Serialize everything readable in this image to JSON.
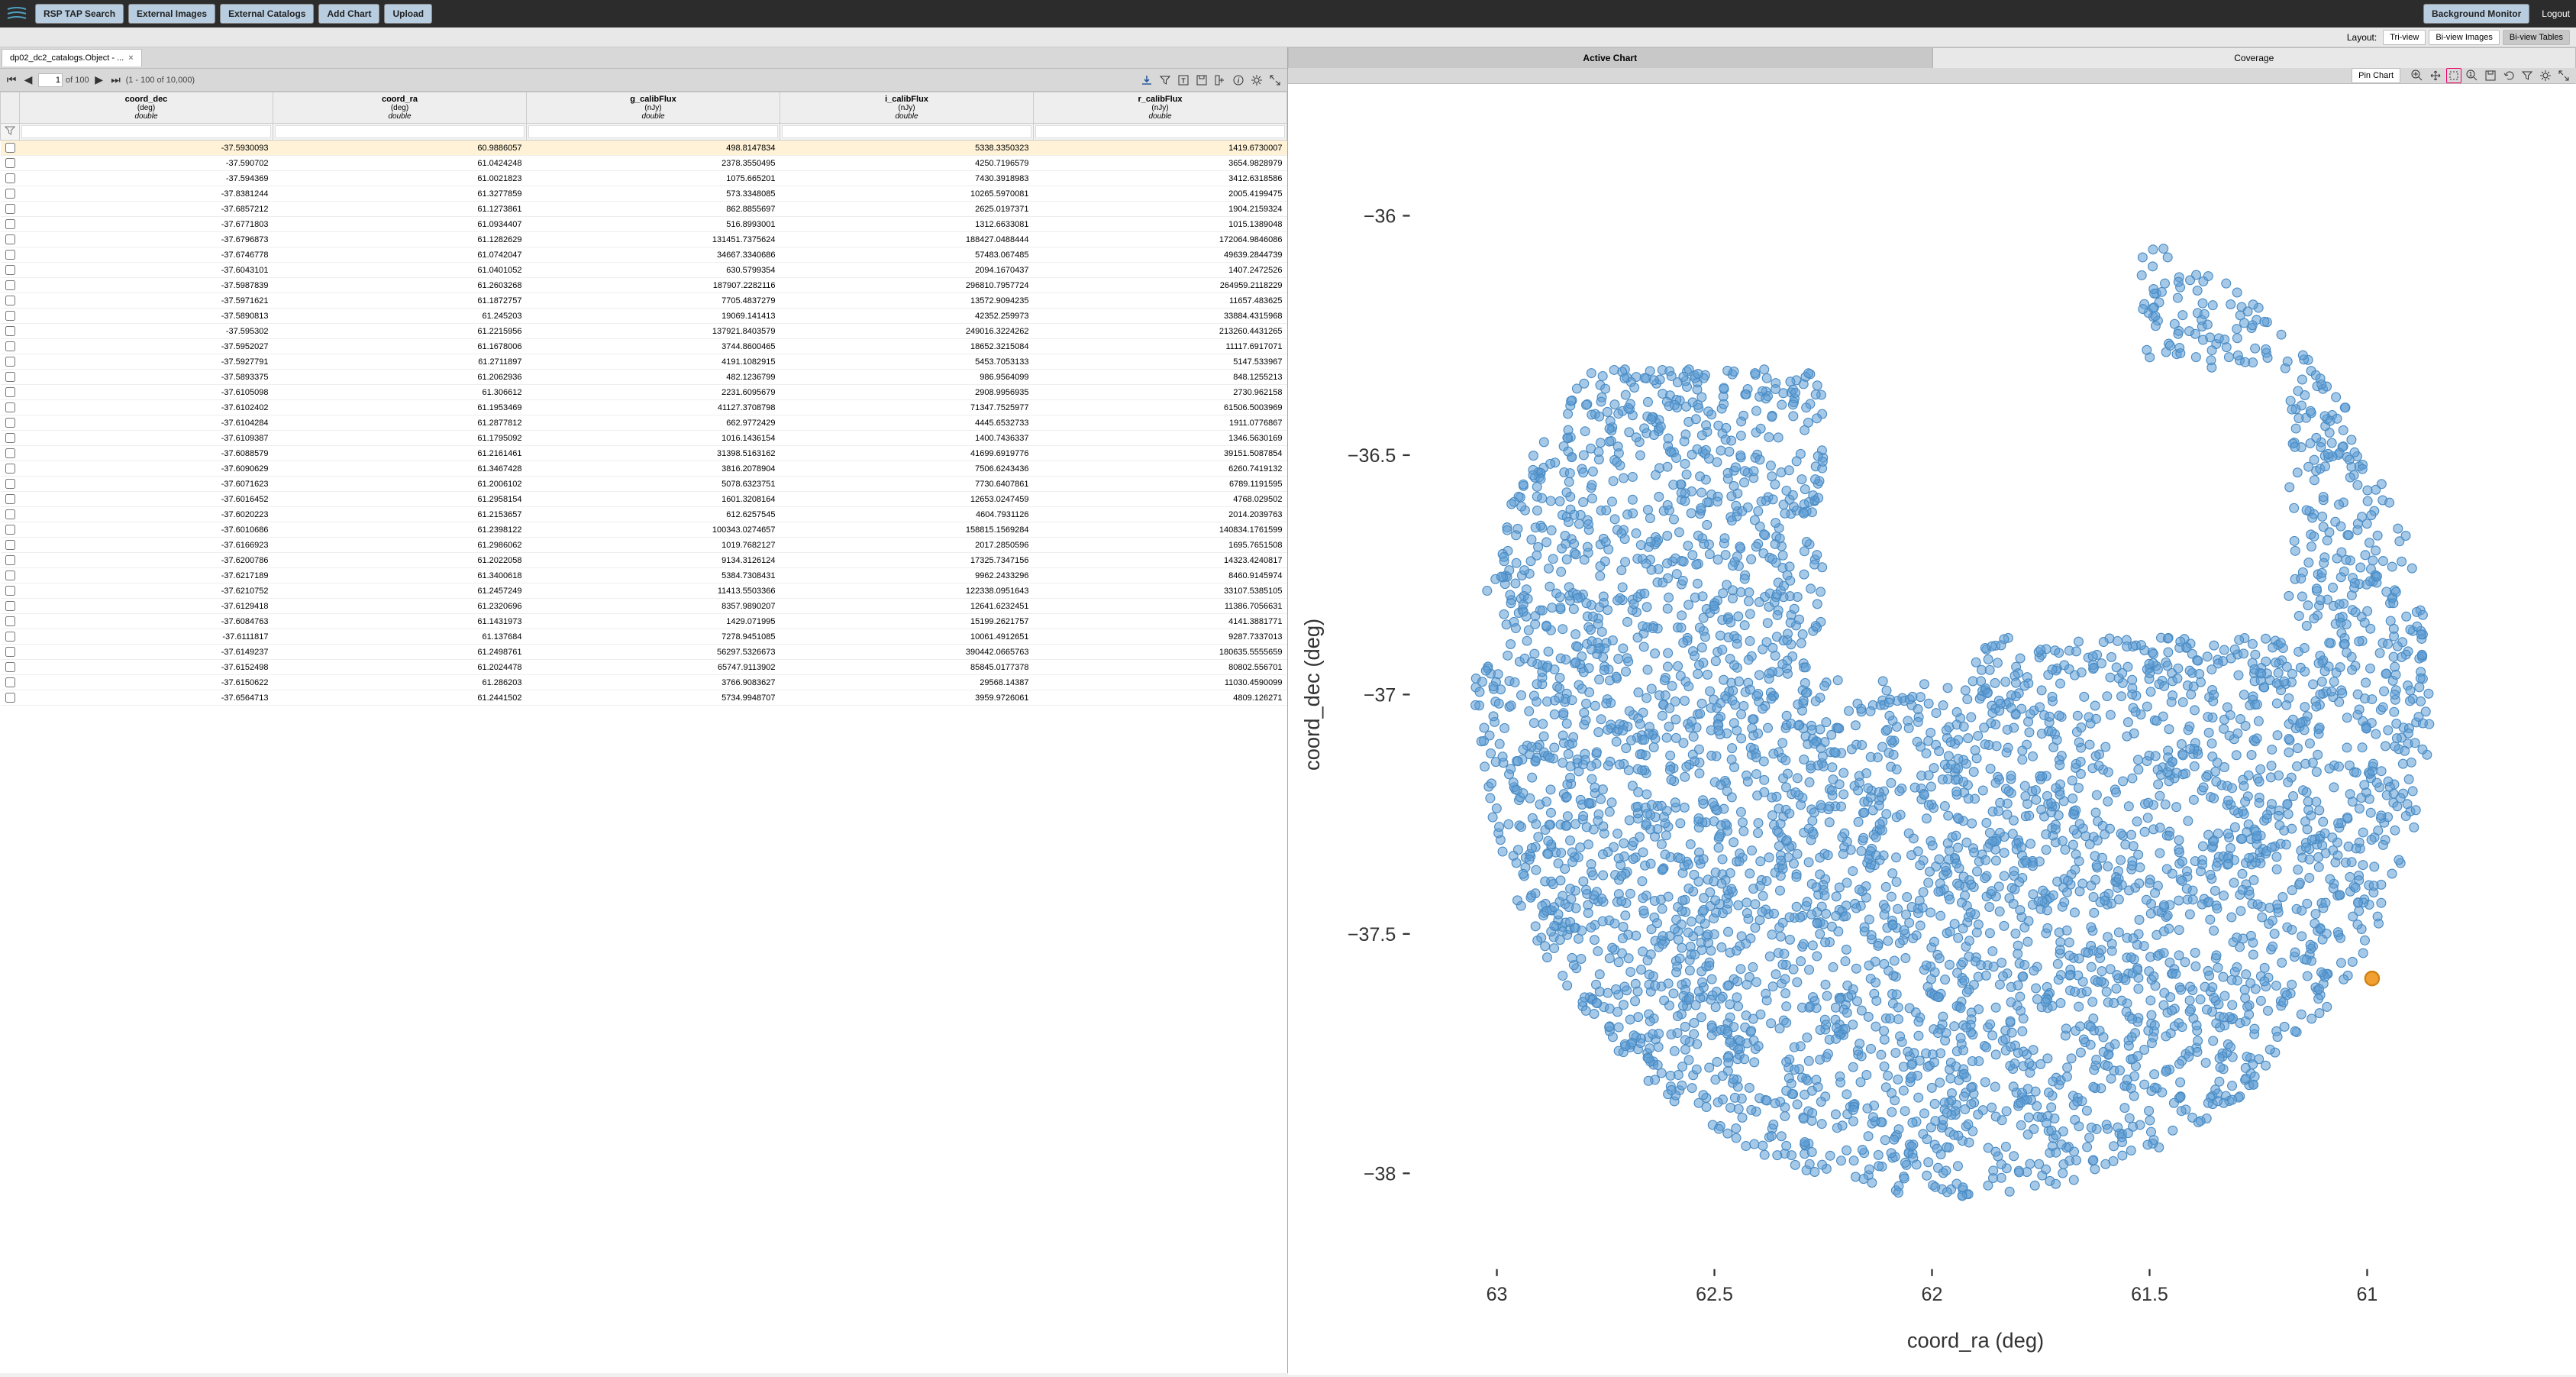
{
  "topbar": {
    "buttons": [
      "RSP TAP Search",
      "External Images",
      "External Catalogs",
      "Add Chart",
      "Upload"
    ],
    "bg_monitor": "Background Monitor",
    "logout": "Logout"
  },
  "layout": {
    "label": "Layout:",
    "options": [
      "Tri-view",
      "Bi-view Images",
      "Bi-view Tables"
    ],
    "active": 2
  },
  "table": {
    "tab_label": "dp02_dc2_catalogs.Object - ...",
    "page_current": "1",
    "page_of": "of 100",
    "row_range": "(1 - 100 of 10,000)",
    "columns": [
      {
        "name": "coord_dec",
        "unit": "(deg)",
        "dtype": "double"
      },
      {
        "name": "coord_ra",
        "unit": "(deg)",
        "dtype": "double"
      },
      {
        "name": "g_calibFlux",
        "unit": "(nJy)",
        "dtype": "double"
      },
      {
        "name": "i_calibFlux",
        "unit": "(nJy)",
        "dtype": "double"
      },
      {
        "name": "r_calibFlux",
        "unit": "(nJy)",
        "dtype": "double"
      }
    ],
    "rows": [
      [
        "-37.5930093",
        "60.9886057",
        "498.8147834",
        "5338.3350323",
        "1419.6730007"
      ],
      [
        "-37.590702",
        "61.0424248",
        "2378.3550495",
        "4250.7196579",
        "3654.9828979"
      ],
      [
        "-37.594369",
        "61.0021823",
        "1075.665201",
        "7430.3918983",
        "3412.6318586"
      ],
      [
        "-37.8381244",
        "61.3277859",
        "573.3348085",
        "10265.5970081",
        "2005.4199475"
      ],
      [
        "-37.6857212",
        "61.1273861",
        "862.8855697",
        "2625.0197371",
        "1904.2159324"
      ],
      [
        "-37.6771803",
        "61.0934407",
        "516.8993001",
        "1312.6633081",
        "1015.1389048"
      ],
      [
        "-37.6796873",
        "61.1282629",
        "131451.7375624",
        "188427.0488444",
        "172064.9846086"
      ],
      [
        "-37.6746778",
        "61.0742047",
        "34667.3340686",
        "57483.067485",
        "49639.2844739"
      ],
      [
        "-37.6043101",
        "61.0401052",
        "630.5799354",
        "2094.1670437",
        "1407.2472526"
      ],
      [
        "-37.5987839",
        "61.2603268",
        "187907.2282116",
        "296810.7957724",
        "264959.2118229"
      ],
      [
        "-37.5971621",
        "61.1872757",
        "7705.4837279",
        "13572.9094235",
        "11657.483625"
      ],
      [
        "-37.5890813",
        "61.245203",
        "19069.141413",
        "42352.259973",
        "33884.4315968"
      ],
      [
        "-37.595302",
        "61.2215956",
        "137921.8403579",
        "249016.3224262",
        "213260.4431265"
      ],
      [
        "-37.5952027",
        "61.1678006",
        "3744.8600465",
        "18652.3215084",
        "11117.6917071"
      ],
      [
        "-37.5927791",
        "61.2711897",
        "4191.1082915",
        "5453.7053133",
        "5147.533967"
      ],
      [
        "-37.5893375",
        "61.2062936",
        "482.1236799",
        "986.9564099",
        "848.1255213"
      ],
      [
        "-37.6105098",
        "61.306612",
        "2231.6095679",
        "2908.9956935",
        "2730.962158"
      ],
      [
        "-37.6102402",
        "61.1953469",
        "41127.3708798",
        "71347.7525977",
        "61506.5003969"
      ],
      [
        "-37.6104284",
        "61.2877812",
        "662.9772429",
        "4445.6532733",
        "1911.0776867"
      ],
      [
        "-37.6109387",
        "61.1795092",
        "1016.1436154",
        "1400.7436337",
        "1346.5630169"
      ],
      [
        "-37.6088579",
        "61.2161461",
        "31398.5163162",
        "41699.6919776",
        "39151.5087854"
      ],
      [
        "-37.6090629",
        "61.3467428",
        "3816.2078904",
        "7506.6243436",
        "6260.7419132"
      ],
      [
        "-37.6071623",
        "61.2006102",
        "5078.6323751",
        "7730.6407861",
        "6789.1191595"
      ],
      [
        "-37.6016452",
        "61.2958154",
        "1601.3208164",
        "12653.0247459",
        "4768.029502"
      ],
      [
        "-37.6020223",
        "61.2153657",
        "612.6257545",
        "4604.7931126",
        "2014.2039763"
      ],
      [
        "-37.6010686",
        "61.2398122",
        "100343.0274657",
        "158815.1569284",
        "140834.1761599"
      ],
      [
        "-37.6166923",
        "61.2986062",
        "1019.7682127",
        "2017.2850596",
        "1695.7651508"
      ],
      [
        "-37.6200786",
        "61.2022058",
        "9134.3126124",
        "17325.7347156",
        "14323.4240817"
      ],
      [
        "-37.6217189",
        "61.3400618",
        "5384.7308431",
        "9962.2433296",
        "8460.9145974"
      ],
      [
        "-37.6210752",
        "61.2457249",
        "11413.5503366",
        "122338.0951643",
        "33107.5385105"
      ],
      [
        "-37.6129418",
        "61.2320696",
        "8357.9890207",
        "12641.6232451",
        "11386.7056631"
      ],
      [
        "-37.6084763",
        "61.1431973",
        "1429.071995",
        "15199.2621757",
        "4141.3881771"
      ],
      [
        "-37.6111817",
        "61.137684",
        "7278.9451085",
        "10061.4912651",
        "9287.7337013"
      ],
      [
        "-37.6149237",
        "61.2498761",
        "56297.5326673",
        "390442.0665763",
        "180635.5555659"
      ],
      [
        "-37.6152498",
        "61.2024478",
        "65747.9113902",
        "85845.0177378",
        "80802.556701"
      ],
      [
        "-37.6150622",
        "61.286203",
        "3766.9083627",
        "29568.14387",
        "11030.4590099"
      ],
      [
        "-37.6564713",
        "61.2441502",
        "5734.9948707",
        "3959.9726061",
        "4809.126271"
      ]
    ],
    "selected_row": 0
  },
  "chart": {
    "tabs": [
      "Active Chart",
      "Coverage"
    ],
    "active_tab": 0,
    "pin_label": "Pin Chart"
  },
  "chart_data": {
    "type": "scatter",
    "title": "",
    "xlabel": "coord_ra (deg)",
    "ylabel": "coord_dec (deg)",
    "xlim": [
      63.2,
      60.6
    ],
    "ylim": [
      -38.2,
      -35.8
    ],
    "x_ticks": [
      63,
      62.5,
      62,
      61.5,
      61
    ],
    "y_ticks": [
      -36,
      -36.5,
      -37,
      -37.5,
      -38
    ],
    "x_tick_labels": [
      "63",
      "62.5",
      "62",
      "61.5",
      "61"
    ],
    "y_tick_labels": [
      "−36",
      "−36.5",
      "−37",
      "−37.5",
      "−38"
    ],
    "highlight": {
      "x": 60.9886057,
      "y": -37.5930093
    },
    "seed": 42,
    "n_points": 4200,
    "disk": {
      "cx": 61.95,
      "cy": -37.0,
      "r": 1.1
    },
    "cutout_rect": {
      "x0": 61.18,
      "x1": 62.25,
      "y0": -36.88,
      "y1": -36.32
    },
    "inner_block": {
      "x0": 61.9,
      "x1": 62.28,
      "y0": -36.97,
      "y1": -36.88
    },
    "top_slice": {
      "x0": 61.52,
      "x1": 63.3,
      "y_above": -36.32
    }
  }
}
